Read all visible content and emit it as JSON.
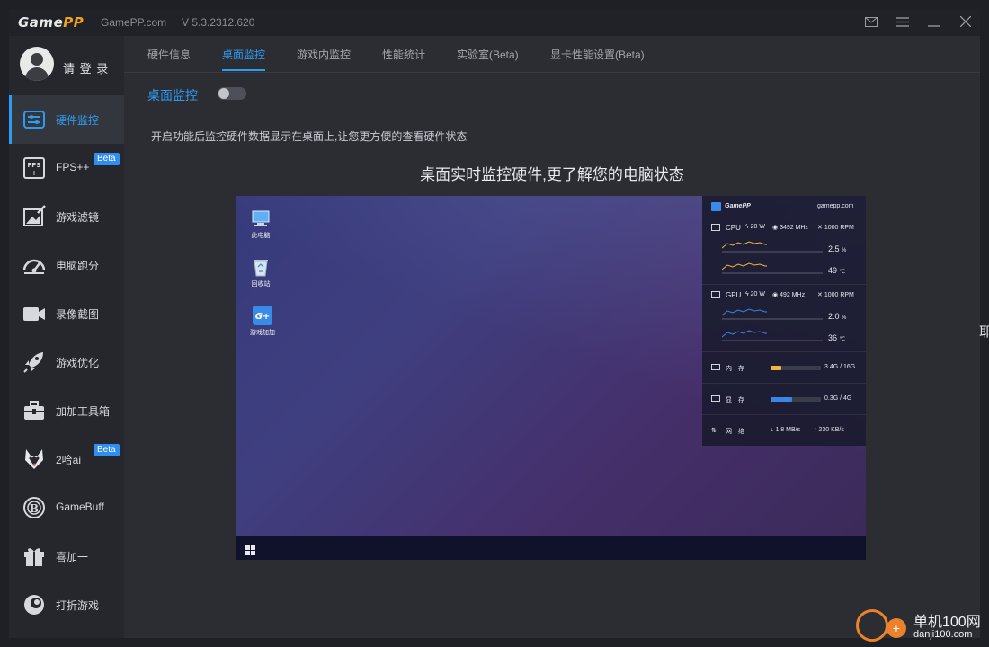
{
  "titlebar": {
    "logo_main": "Game",
    "logo_accent": "PP",
    "site": "GamePP.com",
    "version": "V 5.3.2312.620"
  },
  "sidebar": {
    "login_label": "请 登 录",
    "items": [
      {
        "label": "硬件监控",
        "icon": "hardware-monitor-icon",
        "active": true
      },
      {
        "label": "FPS++",
        "icon": "fps-icon",
        "badge": "Beta"
      },
      {
        "label": "游戏滤镜",
        "icon": "game-filter-icon"
      },
      {
        "label": "电脑跑分",
        "icon": "benchmark-gauge-icon"
      },
      {
        "label": "录像截图",
        "icon": "video-camera-icon"
      },
      {
        "label": "游戏优化",
        "icon": "rocket-icon"
      },
      {
        "label": "加加工具箱",
        "icon": "toolbox-icon"
      },
      {
        "label": "2哈ai",
        "icon": "husky-icon",
        "badge": "Beta"
      },
      {
        "label": "GameBuff",
        "icon": "gamebuff-icon"
      },
      {
        "label": "喜加一",
        "icon": "gift-icon"
      },
      {
        "label": "打折游戏",
        "icon": "discount-icon"
      }
    ]
  },
  "tabs": [
    {
      "label": "硬件信息"
    },
    {
      "label": "桌面监控",
      "active": true
    },
    {
      "label": "游戏内监控"
    },
    {
      "label": "性能統计"
    },
    {
      "label": "实验室(Beta)"
    },
    {
      "label": "显卡性能设置(Beta)"
    }
  ],
  "content": {
    "toggle_label": "桌面监控",
    "toggle_on": false,
    "description": "开启功能后监控硬件数据显示在桌面上,让您更方便的查看硬件状态",
    "headline": "桌面实时监控硬件,更了解您的电脑状态"
  },
  "preview": {
    "desktop_icons": [
      {
        "label": "此电脑",
        "icon": "computer-icon"
      },
      {
        "label": "回收站",
        "icon": "recycle-bin-icon"
      },
      {
        "label": "游戏加加",
        "icon": "gamepp-app-icon"
      }
    ],
    "panel": {
      "brand": "GamePP",
      "site": "gamepp.com",
      "cpu": {
        "label": "CPU",
        "power": "20 W",
        "freq": "3492 MHz",
        "fan": "1000 RPM",
        "usage": "2.5",
        "usage_unit": "%",
        "temp": "49",
        "temp_unit": "℃"
      },
      "gpu": {
        "label": "GPU",
        "power": "20 W",
        "freq": "492 MHz",
        "fan": "1000 RPM",
        "usage": "2.0",
        "usage_unit": "%",
        "temp": "36",
        "temp_unit": "℃"
      },
      "memory": {
        "label": "内　存",
        "value": "3.4G / 16G",
        "fraction": 0.21
      },
      "vram": {
        "label": "显　存",
        "value": "0.3G / 4G",
        "fraction": 0.42
      },
      "network": {
        "label": "网　络",
        "down": "1.8 MB/s",
        "up": "230 KB/s"
      }
    }
  },
  "watermark": {
    "cn": "单机100网",
    "url": "danji100.com"
  },
  "edge_text": "耶",
  "colors": {
    "accent": "#2f9bf0",
    "brand": "#f2a31b",
    "badge": "#2f8ef0",
    "memory_bar": "#f0b73a",
    "vram_bar": "#3a86e6"
  }
}
